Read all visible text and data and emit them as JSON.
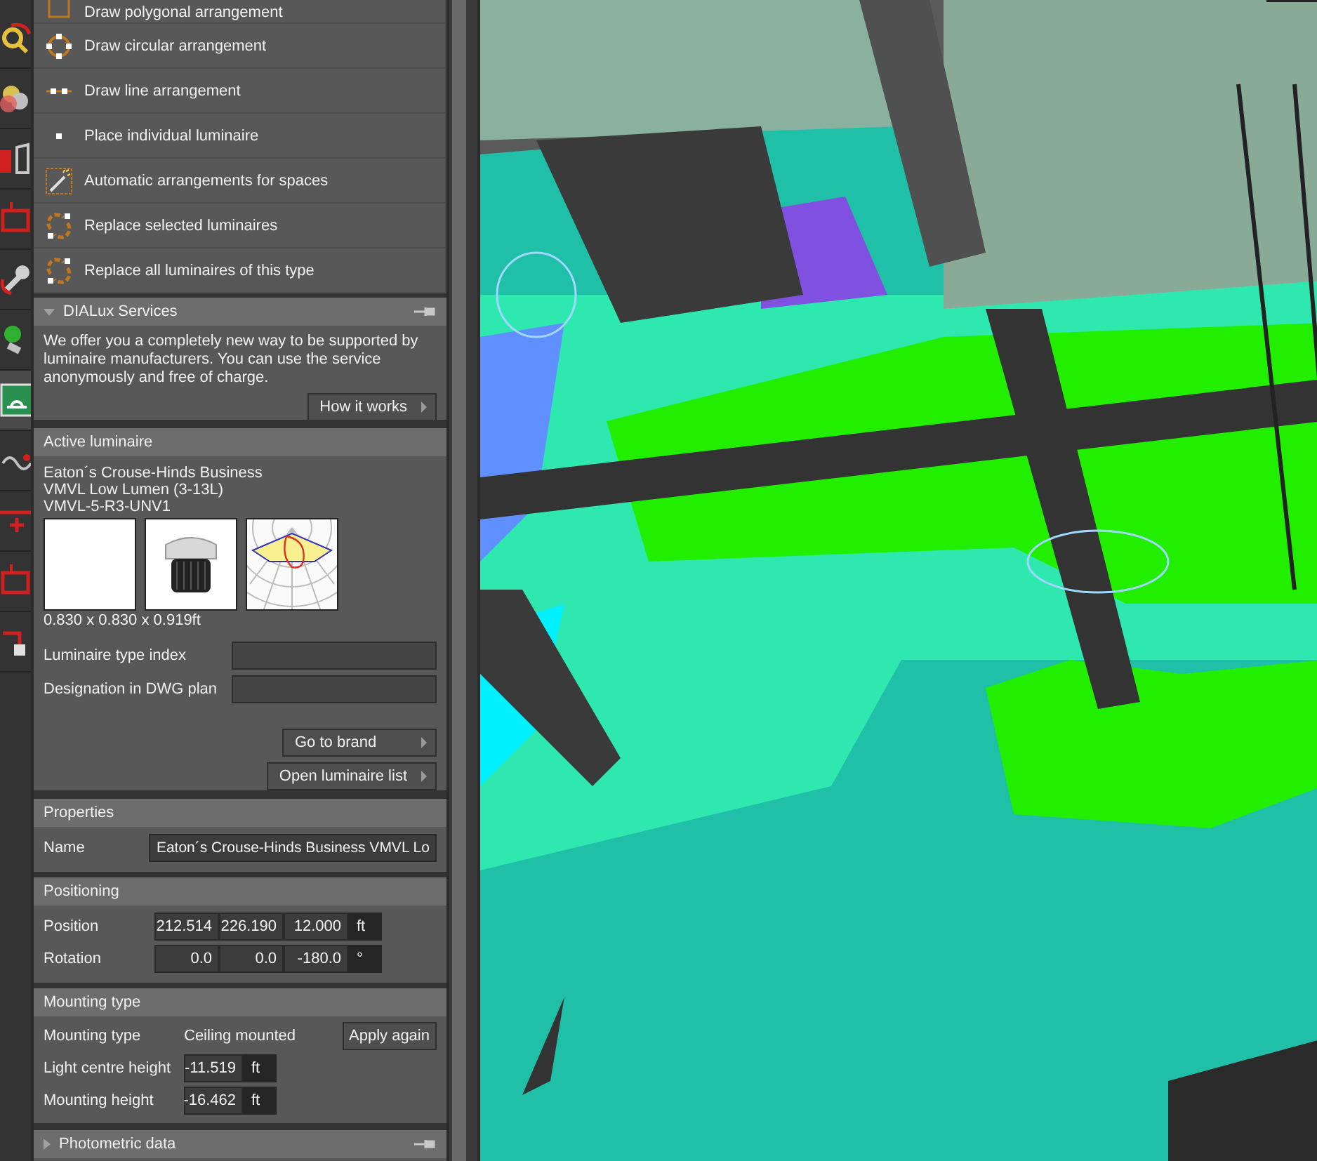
{
  "toolbar": [
    {
      "kind": "magnifier",
      "selected": false
    },
    {
      "kind": "circles",
      "selected": false
    },
    {
      "kind": "door",
      "selected": false
    },
    {
      "kind": "frame",
      "selected": false
    },
    {
      "kind": "wrench",
      "selected": false
    },
    {
      "kind": "plug",
      "selected": false
    },
    {
      "kind": "sign",
      "selected": true
    },
    {
      "kind": "curve",
      "selected": false
    },
    {
      "kind": "plus",
      "selected": false
    },
    {
      "kind": "frame",
      "selected": false
    },
    {
      "kind": "corner",
      "selected": false
    }
  ],
  "arrangement_tools": [
    {
      "kind": "polygon",
      "label": "Draw polygonal arrangement"
    },
    {
      "kind": "circle",
      "label": "Draw circular arrangement"
    },
    {
      "kind": "line",
      "label": "Draw line arrangement"
    },
    {
      "kind": "point",
      "label": "Place individual luminaire"
    },
    {
      "kind": "auto",
      "label": "Automatic arrangements for spaces"
    },
    {
      "kind": "replace",
      "label": "Replace selected luminaires"
    },
    {
      "kind": "replace",
      "label": "Replace all luminaires of this type"
    }
  ],
  "dialux_services": {
    "title": "DIALux Services",
    "expanded": true,
    "text": "We offer you a completely new way to be supported by luminaire manufacturers. You can use the service anonymously and free of charge.",
    "button": "How it works"
  },
  "active_luminaire": {
    "title": "Active luminaire",
    "name_lines": [
      "Eaton´s Crouse-Hinds Business",
      "VMVL Low Lumen (3-13L)",
      "VMVL-5-R3-UNV1"
    ],
    "dimensions": "0.830 x 0.830 x 0.919ft",
    "fields": [
      {
        "label": "Luminaire type index"
      },
      {
        "label": "Designation in DWG plan"
      }
    ],
    "buttons": [
      "Go to brand",
      "Open luminaire list"
    ]
  },
  "properties": {
    "title": "Properties",
    "name_label": "Name",
    "name_value": "Eaton´s Crouse-Hinds Business VMVL Lo"
  },
  "positioning": {
    "title": "Positioning",
    "rows": [
      {
        "label": "Position",
        "values": [
          "212.514",
          "226.190",
          "12.000"
        ],
        "unit": "ft"
      },
      {
        "label": "Rotation",
        "values": [
          "0.0",
          "0.0",
          "-180.0"
        ],
        "unit": "°"
      }
    ]
  },
  "mounting": {
    "title": "Mounting type",
    "type_label": "Mounting type",
    "type_value": "Ceiling mounted",
    "button": "Apply again",
    "rows": [
      {
        "label": "Light centre height",
        "value": "-11.519",
        "unit": "ft"
      },
      {
        "label": "Mounting height",
        "value": "-16.462",
        "unit": "ft"
      }
    ]
  },
  "photometric_data": {
    "title": "Photometric data",
    "expanded": false
  }
}
